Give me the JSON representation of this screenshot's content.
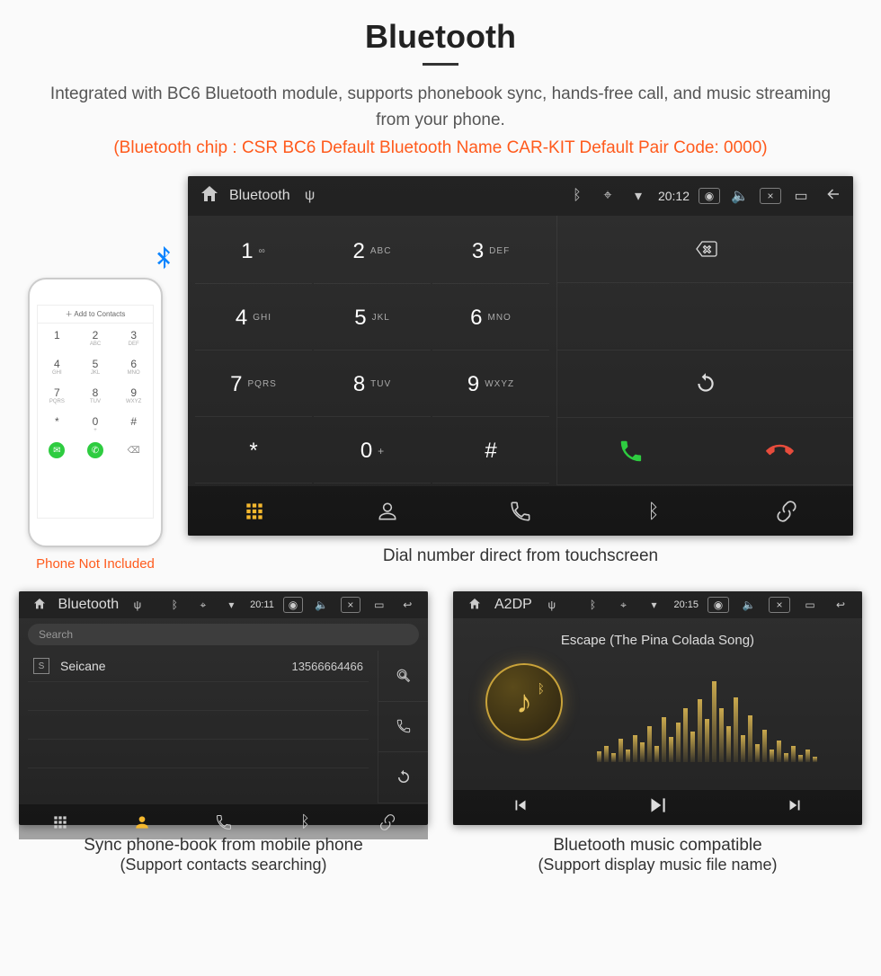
{
  "page": {
    "title": "Bluetooth",
    "description": "Integrated with BC6 Bluetooth module, supports phonebook sync, hands-free call, and music streaming from your phone.",
    "specs": "(Bluetooth chip : CSR BC6     Default Bluetooth Name CAR-KIT     Default Pair Code: 0000)"
  },
  "phone": {
    "add_to_contacts": "Add to Contacts",
    "caption": "Phone Not Included",
    "keys": [
      "1",
      "2",
      "3",
      "4",
      "5",
      "6",
      "7",
      "8",
      "9",
      "*",
      "0",
      "#"
    ],
    "subs": [
      "",
      "ABC",
      "DEF",
      "GHI",
      "JKL",
      "MNO",
      "PQRS",
      "TUV",
      "WXYZ",
      "",
      "+",
      ""
    ]
  },
  "dialer": {
    "statusbar": {
      "title": "Bluetooth",
      "time": "20:12"
    },
    "keys": [
      {
        "num": "1",
        "letters": "∞"
      },
      {
        "num": "2",
        "letters": "ABC"
      },
      {
        "num": "3",
        "letters": "DEF"
      },
      {
        "num": "4",
        "letters": "GHI"
      },
      {
        "num": "5",
        "letters": "JKL"
      },
      {
        "num": "6",
        "letters": "MNO"
      },
      {
        "num": "7",
        "letters": "PQRS"
      },
      {
        "num": "8",
        "letters": "TUV"
      },
      {
        "num": "9",
        "letters": "WXYZ"
      },
      {
        "num": "*",
        "letters": ""
      },
      {
        "num": "0",
        "letters": "+"
      },
      {
        "num": "#",
        "letters": ""
      }
    ],
    "caption": "Dial number direct from touchscreen"
  },
  "contacts": {
    "statusbar": {
      "title": "Bluetooth",
      "time": "20:11"
    },
    "search_placeholder": "Search",
    "list": [
      {
        "initial": "S",
        "name": "Seicane",
        "number": "13566664466"
      }
    ],
    "caption_line1": "Sync phone-book from mobile phone",
    "caption_line2": "(Support contacts searching)"
  },
  "music": {
    "statusbar": {
      "title": "A2DP",
      "time": "20:15"
    },
    "track": "Escape (The Pina Colada Song)",
    "caption_line1": "Bluetooth music compatible",
    "caption_line2": "(Support display music file name)"
  },
  "eq_heights": [
    12,
    18,
    10,
    26,
    14,
    30,
    22,
    40,
    18,
    50,
    28,
    44,
    60,
    34,
    70,
    48,
    90,
    60,
    40,
    72,
    30,
    52,
    20,
    36,
    14,
    24,
    10,
    18,
    8,
    14,
    6
  ]
}
